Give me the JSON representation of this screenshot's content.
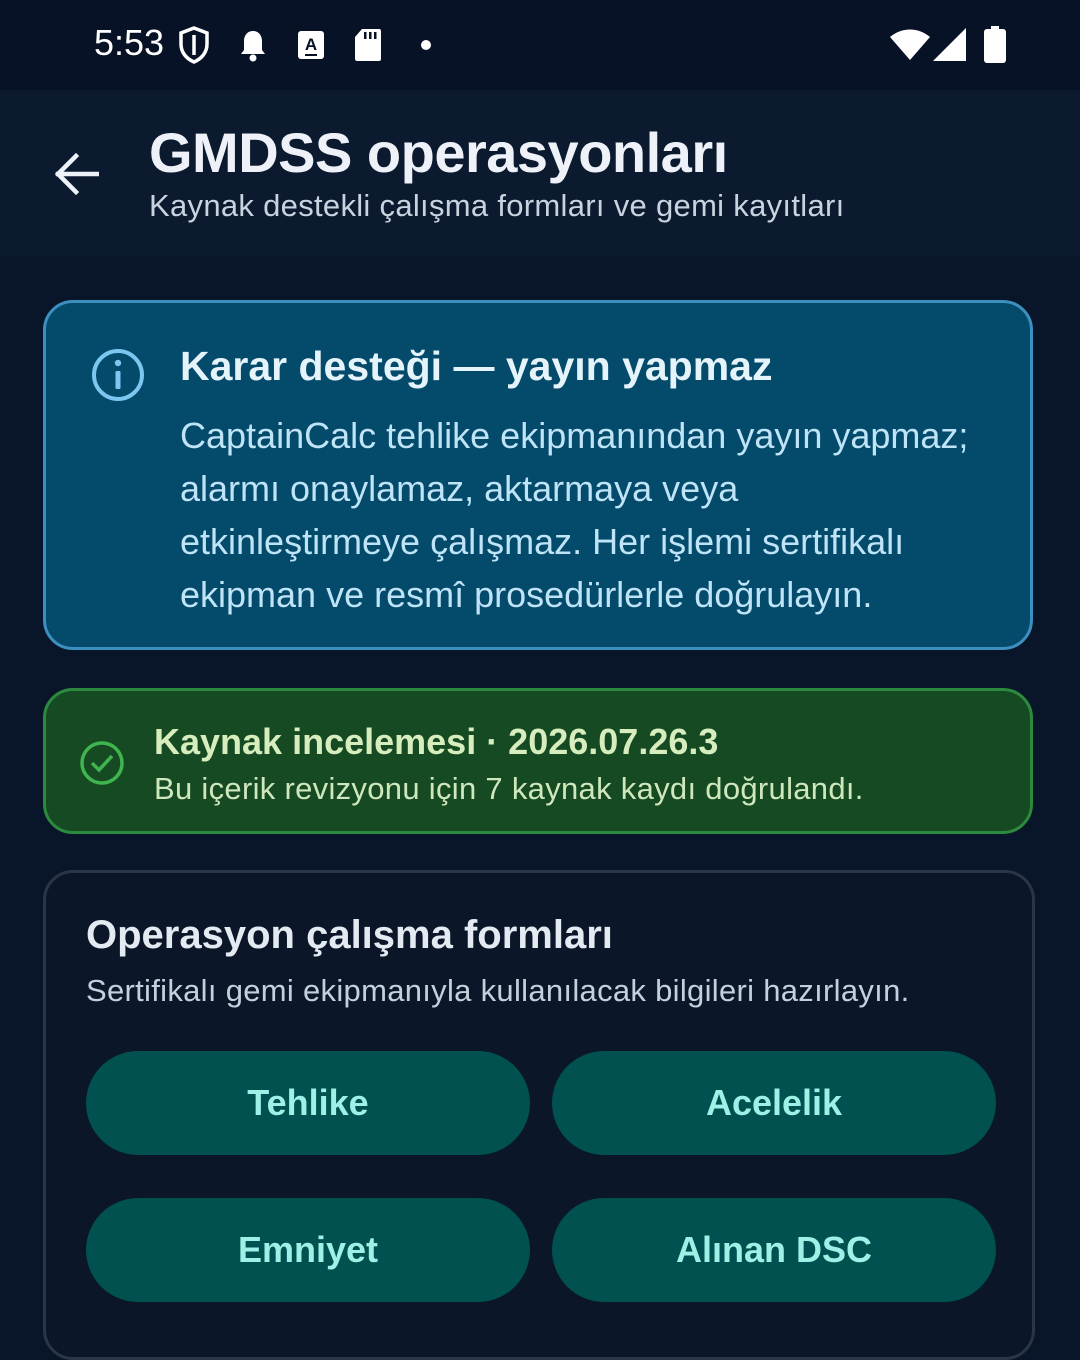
{
  "status_bar": {
    "time": "5:53",
    "icons": [
      "shield-icon",
      "notification-bell-icon",
      "keyboard-a-icon",
      "sd-card-icon",
      "dot-icon",
      "wifi-icon",
      "cell-signal-icon",
      "battery-icon"
    ]
  },
  "app_bar": {
    "title": "GMDSS operasyonları",
    "subtitle": "Kaynak destekli çalışma formları ve gemi kayıtları",
    "back_icon": "arrow-back-icon"
  },
  "info_card": {
    "icon": "info-icon",
    "title": "Karar desteği — yayın yapmaz",
    "lines": [
      "CaptainCalc tehlike ekipmanından yayın yapmaz;",
      "alarmı onaylamaz, aktarmaya veya",
      "etkinleştirmeye çalışmaz. Her işlemi sertifikalı",
      "ekipman ve resmî prosedürlerle doğrulayın."
    ],
    "colors": {
      "background": "#034a6b",
      "border": "#3c8fbf"
    }
  },
  "review_card": {
    "icon": "check-circle-icon",
    "title": "Kaynak incelemesi · 2026.07.26.3",
    "body": "Bu içerik revizyonu için 7 kaynak kaydı doğrulandı.",
    "colors": {
      "background": "#154a22",
      "border": "#2c8a3e"
    }
  },
  "forms_card": {
    "title": "Operasyon çalışma formları",
    "subtitle": "Sertifikalı gemi ekipmanıyla kullanılacak bilgileri hazırlayın.",
    "buttons": [
      "Tehlike",
      "Acelelik",
      "Emniyet",
      "Alınan DSC"
    ],
    "colors": {
      "button_bg": "#00514f",
      "button_text": "#9ef1e7"
    }
  }
}
